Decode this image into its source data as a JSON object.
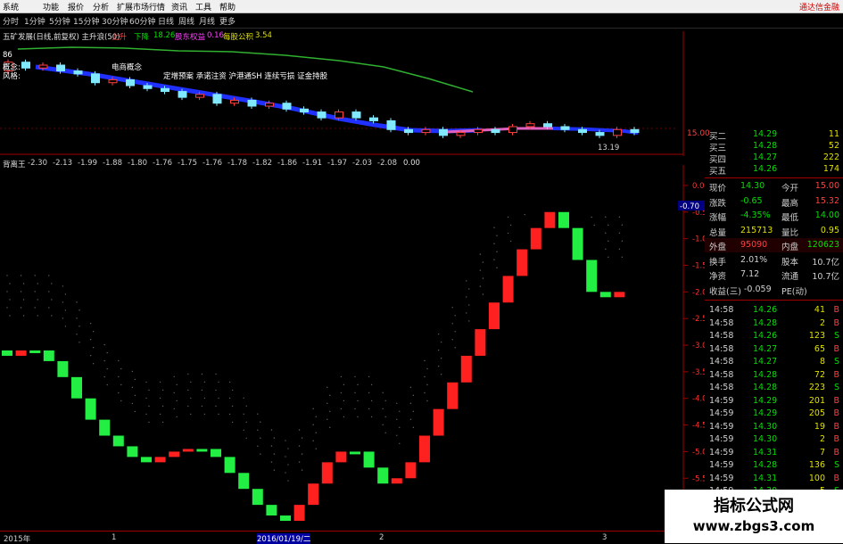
{
  "menubar": {
    "items": [
      "系统",
      "功能",
      "报价",
      "分析",
      "扩展市场行情",
      "资讯",
      "工具",
      "帮助"
    ],
    "brand": "通达信金融"
  },
  "toolbar": {
    "periods": [
      "分时",
      "1分钟",
      "5分钟",
      "15分钟",
      "30分钟",
      "60分钟",
      "日线",
      "周线",
      "月线",
      "更多"
    ]
  },
  "main_header": {
    "title": "五矿发展(日线,前复权) 主升浪(50)",
    "up": "上升",
    "down": "下降",
    "down_val": "18.26",
    "profit": "股东权益",
    "profit_val": "0.16",
    "eps": "每股公积",
    "eps_val": "3.54"
  },
  "overlay_text": {
    "line1": "概念:",
    "concepts": "电商概念",
    "line2": "风格:",
    "styles": "定增预案 承诺注资 沪港通SH 连续亏损 证金持股",
    "stock_left": "86"
  },
  "price_axis": {
    "label": "15.00"
  },
  "price_min_label": "13.19",
  "indicator": {
    "name": "背离王",
    "values": [
      "-2.30",
      "-2.13",
      "-1.99",
      "-1.88",
      "-1.80",
      "-1.76",
      "-1.75",
      "-1.76",
      "-1.78",
      "-1.82",
      "-1.86",
      "-1.91",
      "-1.97",
      "-2.03",
      "-2.08"
    ],
    "last": "0.00"
  },
  "y_axis": {
    "labels": [
      "0.00",
      "-0.50",
      "-1.00",
      "-1.50",
      "-2.00",
      "-2.50",
      "-3.00",
      "-3.50",
      "-4.00",
      "-4.50",
      "-5.00",
      "-5.50",
      "-6.00"
    ],
    "marker": "-0.70"
  },
  "x_axis": {
    "labels": [
      "2015年",
      "1",
      "2016/01/19/二",
      "2",
      "3"
    ]
  },
  "bids": [
    {
      "label": "买二",
      "price": "14.29",
      "vol": "11"
    },
    {
      "label": "买三",
      "price": "14.28",
      "vol": "52"
    },
    {
      "label": "买四",
      "price": "14.27",
      "vol": "222"
    },
    {
      "label": "买五",
      "price": "14.26",
      "vol": "174"
    }
  ],
  "stats": [
    {
      "l1": "现价",
      "v1": "14.30",
      "l2": "今开",
      "v2": "15.00",
      "c1": "#00e000",
      "c2": "#ff4040"
    },
    {
      "l1": "涨跌",
      "v1": "-0.65",
      "l2": "最高",
      "v2": "15.32",
      "c1": "#00e000",
      "c2": "#ff4040"
    },
    {
      "l1": "涨幅",
      "v1": "-4.35%",
      "l2": "最低",
      "v2": "14.00",
      "c1": "#00e000",
      "c2": "#00e000"
    },
    {
      "l1": "总量",
      "v1": "215713",
      "l2": "量比",
      "v2": "0.95",
      "c1": "#e0e000",
      "c2": "#e0e000"
    },
    {
      "l1": "外盘",
      "v1": "95090",
      "l2": "内盘",
      "v2": "120623",
      "c1": "#ff4040",
      "c2": "#00e000"
    },
    {
      "l1": "换手",
      "v1": "2.01%",
      "l2": "股本",
      "v2": "10.7亿",
      "c1": "#d0d0d0",
      "c2": "#d0d0d0"
    },
    {
      "l1": "净资",
      "v1": "7.12",
      "l2": "流通",
      "v2": "10.7亿",
      "c1": "#d0d0d0",
      "c2": "#d0d0d0"
    },
    {
      "l1": "收益(三)",
      "v1": "-0.059",
      "l2": "PE(动)",
      "v2": "",
      "c1": "#d0d0d0",
      "c2": "#d0d0d0"
    }
  ],
  "ticks": [
    {
      "t": "14:58",
      "p": "14.26",
      "v": "41",
      "s": "B"
    },
    {
      "t": "14:58",
      "p": "14.28",
      "v": "2",
      "s": "B"
    },
    {
      "t": "14:58",
      "p": "14.26",
      "v": "123",
      "s": "S"
    },
    {
      "t": "14:58",
      "p": "14.27",
      "v": "65",
      "s": "B"
    },
    {
      "t": "14:58",
      "p": "14.27",
      "v": "8",
      "s": "S"
    },
    {
      "t": "14:58",
      "p": "14.28",
      "v": "72",
      "s": "B"
    },
    {
      "t": "14:58",
      "p": "14.28",
      "v": "223",
      "s": "S"
    },
    {
      "t": "14:59",
      "p": "14.29",
      "v": "201",
      "s": "B"
    },
    {
      "t": "14:59",
      "p": "14.29",
      "v": "205",
      "s": "B"
    },
    {
      "t": "14:59",
      "p": "14.30",
      "v": "19",
      "s": "B"
    },
    {
      "t": "14:59",
      "p": "14.30",
      "v": "2",
      "s": "B"
    },
    {
      "t": "14:59",
      "p": "14.31",
      "v": "7",
      "s": "B"
    },
    {
      "t": "14:59",
      "p": "14.28",
      "v": "136",
      "s": "S"
    },
    {
      "t": "14:59",
      "p": "14.31",
      "v": "100",
      "s": "B"
    },
    {
      "t": "14:59",
      "p": "14.30",
      "v": "5",
      "s": "S"
    }
  ],
  "colors": {
    "up": "#ff2020",
    "down": "#22ee44",
    "axis": "#a00000",
    "cyan": "#80e8ff",
    "blue": "#2030ff"
  },
  "indicator_series": [
    -3.2,
    -3.1,
    -3.1,
    -3.3,
    -3.6,
    -4.0,
    -4.4,
    -4.7,
    -4.9,
    -5.1,
    -5.2,
    -5.1,
    -5.0,
    -4.95,
    -4.95,
    -5.1,
    -5.4,
    -5.7,
    -6.0,
    -6.2,
    -6.3,
    -6.0,
    -5.6,
    -5.2,
    -5.0,
    -5.0,
    -5.3,
    -5.6,
    -5.5,
    -5.2,
    -4.7,
    -4.2,
    -3.7,
    -3.2,
    -2.7,
    -2.2,
    -1.7,
    -1.2,
    -0.8,
    -0.5,
    -0.8,
    -1.4,
    -2.0,
    -2.1,
    -2.0
  ],
  "price_candles": [
    {
      "o": 15.6,
      "c": 15.9
    },
    {
      "o": 15.9,
      "c": 15.7
    },
    {
      "o": 15.7,
      "c": 15.8
    },
    {
      "o": 15.8,
      "c": 15.6
    },
    {
      "o": 15.6,
      "c": 15.5
    },
    {
      "o": 15.5,
      "c": 15.2
    },
    {
      "o": 15.2,
      "c": 15.3
    },
    {
      "o": 15.3,
      "c": 15.1
    },
    {
      "o": 15.1,
      "c": 15.0
    },
    {
      "o": 15.0,
      "c": 14.9
    },
    {
      "o": 14.9,
      "c": 14.7
    },
    {
      "o": 14.7,
      "c": 14.8
    },
    {
      "o": 14.8,
      "c": 14.5
    },
    {
      "o": 14.5,
      "c": 14.6
    },
    {
      "o": 14.6,
      "c": 14.4
    },
    {
      "o": 14.4,
      "c": 14.5
    },
    {
      "o": 14.5,
      "c": 14.3
    },
    {
      "o": 14.3,
      "c": 14.2
    },
    {
      "o": 14.2,
      "c": 14.0
    },
    {
      "o": 14.0,
      "c": 14.2
    },
    {
      "o": 14.2,
      "c": 14.0
    },
    {
      "o": 14.0,
      "c": 13.9
    },
    {
      "o": 13.9,
      "c": 13.6
    },
    {
      "o": 13.6,
      "c": 13.5
    },
    {
      "o": 13.5,
      "c": 13.6
    },
    {
      "o": 13.6,
      "c": 13.4
    },
    {
      "o": 13.4,
      "c": 13.5
    },
    {
      "o": 13.5,
      "c": 13.6
    },
    {
      "o": 13.6,
      "c": 13.5
    },
    {
      "o": 13.5,
      "c": 13.7
    },
    {
      "o": 13.7,
      "c": 13.8
    },
    {
      "o": 13.8,
      "c": 13.7
    },
    {
      "o": 13.7,
      "c": 13.6
    },
    {
      "o": 13.6,
      "c": 13.5
    },
    {
      "o": 13.5,
      "c": 13.4
    },
    {
      "o": 13.4,
      "c": 13.6
    },
    {
      "o": 13.6,
      "c": 13.5
    }
  ]
}
